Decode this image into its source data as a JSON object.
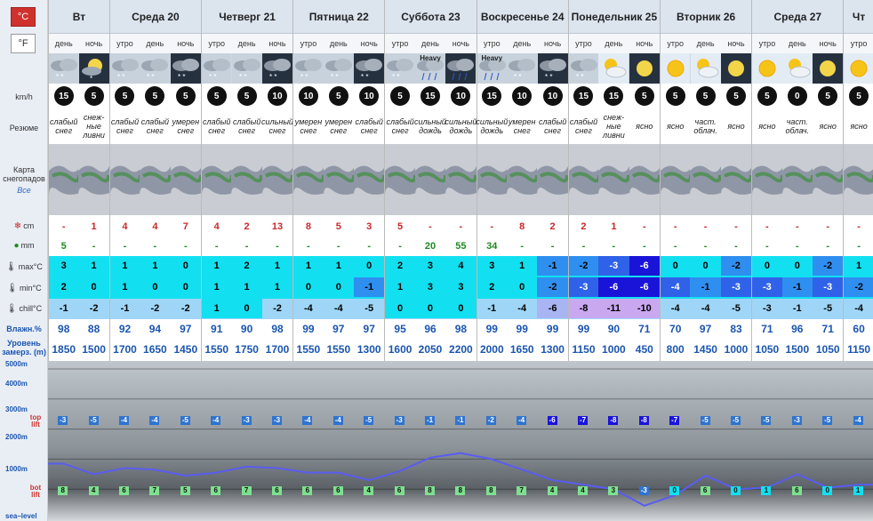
{
  "units": {
    "celsius": "°C",
    "fahrenheit": "°F"
  },
  "labels": {
    "wind": "km/h",
    "summary": "Резюме",
    "snowmap": "Карта снегопадов",
    "snowmap_all": "Все",
    "snow": "cm",
    "rain": "mm",
    "max": "max°C",
    "min": "min°C",
    "chill": "chill°C",
    "humidity": "Влажн.%",
    "freezing": "Уровень замерз. (m)",
    "top_lift": "top lift",
    "bot_lift": "bot lift",
    "sea_level": "sea–level"
  },
  "altitude_marks": [
    "5000m",
    "4000m",
    "3000m",
    "2000m",
    "1000m"
  ],
  "days": [
    {
      "name": "Вт",
      "span": 2
    },
    {
      "name": "Среда 20",
      "span": 3
    },
    {
      "name": "Четверг 21",
      "span": 3
    },
    {
      "name": "Пятница 22",
      "span": 3
    },
    {
      "name": "Суббота 23",
      "span": 3
    },
    {
      "name": "Воскресенье 24",
      "span": 3
    },
    {
      "name": "Понедельник 25",
      "span": 3
    },
    {
      "name": "Вторник 26",
      "span": 3
    },
    {
      "name": "Среда 27",
      "span": 3
    },
    {
      "name": "Чт",
      "span": 1
    }
  ],
  "periods": [
    {
      "tod": "день",
      "wx": "cloud-snow",
      "heavy": "",
      "wind": "15",
      "sum": "слабый снег",
      "snow": "-",
      "rain": "5",
      "max": "3",
      "min": "2",
      "chill": "-1",
      "hum": "98",
      "frz": "1850",
      "top": "-3",
      "bot": "8"
    },
    {
      "tod": "ночь",
      "wx": "moon-snow",
      "heavy": "",
      "wind": "5",
      "sum": "снеж-ные ливни",
      "snow": "1",
      "rain": "-",
      "max": "1",
      "min": "0",
      "chill": "-2",
      "hum": "88",
      "frz": "1500",
      "top": "-5",
      "bot": "4"
    },
    {
      "tod": "утро",
      "wx": "cloud-snow",
      "heavy": "",
      "wind": "5",
      "sum": "слабый снег",
      "snow": "4",
      "rain": "-",
      "max": "1",
      "min": "1",
      "chill": "-1",
      "hum": "92",
      "frz": "1700",
      "top": "-4",
      "bot": "6"
    },
    {
      "tod": "день",
      "wx": "cloud-snow",
      "heavy": "",
      "wind": "5",
      "sum": "слабый снег",
      "snow": "4",
      "rain": "-",
      "max": "1",
      "min": "0",
      "chill": "-2",
      "hum": "94",
      "frz": "1650",
      "top": "-4",
      "bot": "7"
    },
    {
      "tod": "ночь",
      "wx": "night-snow",
      "heavy": "",
      "wind": "5",
      "sum": "умерен снег",
      "snow": "7",
      "rain": "-",
      "max": "0",
      "min": "0",
      "chill": "-2",
      "hum": "97",
      "frz": "1450",
      "top": "-5",
      "bot": "5"
    },
    {
      "tod": "утро",
      "wx": "cloud-snow",
      "heavy": "",
      "wind": "5",
      "sum": "слабый снег",
      "snow": "4",
      "rain": "-",
      "max": "1",
      "min": "1",
      "chill": "1",
      "hum": "91",
      "frz": "1550",
      "top": "-4",
      "bot": "6"
    },
    {
      "tod": "день",
      "wx": "cloud-snow",
      "heavy": "",
      "wind": "5",
      "sum": "слабый снег",
      "snow": "2",
      "rain": "-",
      "max": "2",
      "min": "1",
      "chill": "0",
      "hum": "90",
      "frz": "1750",
      "top": "-3",
      "bot": "7"
    },
    {
      "tod": "ночь",
      "wx": "night-snow",
      "heavy": "",
      "wind": "10",
      "sum": "сильный снег",
      "snow": "13",
      "rain": "-",
      "max": "1",
      "min": "1",
      "chill": "-2",
      "hum": "98",
      "frz": "1700",
      "top": "-3",
      "bot": "6"
    },
    {
      "tod": "утро",
      "wx": "cloud-snow",
      "heavy": "",
      "wind": "10",
      "sum": "умерен снег",
      "snow": "8",
      "rain": "-",
      "max": "1",
      "min": "0",
      "chill": "-4",
      "hum": "99",
      "frz": "1550",
      "top": "-4",
      "bot": "6"
    },
    {
      "tod": "день",
      "wx": "cloud-snow",
      "heavy": "",
      "wind": "5",
      "sum": "умерен снег",
      "snow": "5",
      "rain": "-",
      "max": "1",
      "min": "0",
      "chill": "-4",
      "hum": "97",
      "frz": "1550",
      "top": "-4",
      "bot": "6"
    },
    {
      "tod": "ночь",
      "wx": "night-snow",
      "heavy": "",
      "wind": "10",
      "sum": "слабый снег",
      "snow": "3",
      "rain": "-",
      "max": "0",
      "min": "-1",
      "chill": "-5",
      "hum": "97",
      "frz": "1300",
      "top": "-5",
      "bot": "4"
    },
    {
      "tod": "утро",
      "wx": "cloud-snow",
      "heavy": "",
      "wind": "5",
      "sum": "слабый снег",
      "snow": "5",
      "rain": "-",
      "max": "2",
      "min": "1",
      "chill": "0",
      "hum": "95",
      "frz": "1600",
      "top": "-3",
      "bot": "6"
    },
    {
      "tod": "день",
      "wx": "cloud-rain",
      "heavy": "Heavy",
      "wind": "15",
      "sum": "сильный дождь",
      "snow": "-",
      "rain": "20",
      "max": "3",
      "min": "3",
      "chill": "0",
      "hum": "96",
      "frz": "2050",
      "top": "-1",
      "bot": "8"
    },
    {
      "tod": "ночь",
      "wx": "night-rain",
      "heavy": "",
      "wind": "10",
      "sum": "сильный дождь",
      "snow": "-",
      "rain": "55",
      "max": "4",
      "min": "3",
      "chill": "0",
      "hum": "98",
      "frz": "2200",
      "top": "-1",
      "bot": "8"
    },
    {
      "tod": "утро",
      "wx": "cloud-rain",
      "heavy": "Heavy",
      "wind": "15",
      "sum": "сильный дождь",
      "snow": "-",
      "rain": "34",
      "max": "3",
      "min": "2",
      "chill": "-1",
      "hum": "99",
      "frz": "2000",
      "top": "-2",
      "bot": "8"
    },
    {
      "tod": "день",
      "wx": "cloud-snow",
      "heavy": "",
      "wind": "10",
      "sum": "умерен снег",
      "snow": "8",
      "rain": "-",
      "max": "1",
      "min": "0",
      "chill": "-4",
      "hum": "99",
      "frz": "1650",
      "top": "-4",
      "bot": "7"
    },
    {
      "tod": "ночь",
      "wx": "night-snow",
      "heavy": "",
      "wind": "10",
      "sum": "слабый снег",
      "snow": "2",
      "rain": "-",
      "max": "-1",
      "min": "-2",
      "chill": "-6",
      "hum": "99",
      "frz": "1300",
      "top": "-6",
      "bot": "4"
    },
    {
      "tod": "утро",
      "wx": "cloud-snow",
      "heavy": "",
      "wind": "15",
      "sum": "слабый снег",
      "snow": "2",
      "rain": "-",
      "max": "-2",
      "min": "-3",
      "chill": "-8",
      "hum": "99",
      "frz": "1150",
      "top": "-7",
      "bot": "4"
    },
    {
      "tod": "день",
      "wx": "sun-cloud",
      "heavy": "",
      "wind": "15",
      "sum": "снеж-ные ливни",
      "snow": "1",
      "rain": "-",
      "max": "-3",
      "min": "-6",
      "chill": "-11",
      "hum": "90",
      "frz": "1000",
      "top": "-8",
      "bot": "3"
    },
    {
      "tod": "ночь",
      "wx": "moon",
      "heavy": "",
      "wind": "5",
      "sum": "ясно",
      "snow": "-",
      "rain": "-",
      "max": "-6",
      "min": "-6",
      "chill": "-10",
      "hum": "71",
      "frz": "450",
      "top": "-8",
      "bot": "-3"
    },
    {
      "tod": "утро",
      "wx": "sun",
      "heavy": "",
      "wind": "5",
      "sum": "ясно",
      "snow": "-",
      "rain": "-",
      "max": "0",
      "min": "-4",
      "chill": "-4",
      "hum": "70",
      "frz": "800",
      "top": "-7",
      "bot": "0"
    },
    {
      "tod": "день",
      "wx": "sun-cloud",
      "heavy": "",
      "wind": "5",
      "sum": "част. облач.",
      "snow": "-",
      "rain": "-",
      "max": "0",
      "min": "-1",
      "chill": "-4",
      "hum": "97",
      "frz": "1450",
      "top": "-5",
      "bot": "6"
    },
    {
      "tod": "ночь",
      "wx": "moon",
      "heavy": "",
      "wind": "5",
      "sum": "ясно",
      "snow": "-",
      "rain": "-",
      "max": "-2",
      "min": "-3",
      "chill": "-5",
      "hum": "83",
      "frz": "1000",
      "top": "-5",
      "bot": "0"
    },
    {
      "tod": "утро",
      "wx": "sun",
      "heavy": "",
      "wind": "5",
      "sum": "ясно",
      "snow": "-",
      "rain": "-",
      "max": "0",
      "min": "-3",
      "chill": "-3",
      "hum": "71",
      "frz": "1050",
      "top": "-5",
      "bot": "1"
    },
    {
      "tod": "день",
      "wx": "sun-cloud",
      "heavy": "",
      "wind": "0",
      "sum": "част. облач.",
      "snow": "-",
      "rain": "-",
      "max": "0",
      "min": "-1",
      "chill": "-1",
      "hum": "96",
      "frz": "1500",
      "top": "-3",
      "bot": "6"
    },
    {
      "tod": "ночь",
      "wx": "moon",
      "heavy": "",
      "wind": "5",
      "sum": "ясно",
      "snow": "-",
      "rain": "-",
      "max": "-2",
      "min": "-3",
      "chill": "-5",
      "hum": "71",
      "frz": "1050",
      "top": "-5",
      "bot": "0"
    },
    {
      "tod": "утро",
      "wx": "sun",
      "heavy": "",
      "wind": "5",
      "sum": "ясно",
      "snow": "-",
      "rain": "-",
      "max": "1",
      "min": "-2",
      "chill": "-4",
      "hum": "60",
      "frz": "1150",
      "top": "-4",
      "bot": "1"
    }
  ]
}
